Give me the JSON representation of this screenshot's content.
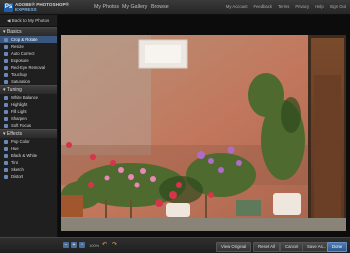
{
  "header": {
    "logo_line1": "ADOBE® PHOTOSHOP®",
    "logo_line2": "EXPRESS",
    "nav": [
      "My Photos",
      "My Gallery",
      "Browse"
    ],
    "links": [
      "My Account",
      "Feedback",
      "Terms",
      "Privacy",
      "Help",
      "Sign Out"
    ]
  },
  "sidebar": {
    "back": "◀ Back to My Photos",
    "sections": [
      {
        "title": "▾ Basics",
        "items": [
          "Crop & Rotate",
          "Resize",
          "Auto Correct",
          "Exposure",
          "Red-Eye Removal",
          "Touchup",
          "Saturation"
        ]
      },
      {
        "title": "▾ Tuning",
        "items": [
          "White Balance",
          "Highlight",
          "Fill Light",
          "Sharpen",
          "Soft Focus"
        ]
      },
      {
        "title": "▾ Effects",
        "items": [
          "Pop Color",
          "Hue",
          "Black & White",
          "Tint",
          "Sketch",
          "Distort"
        ]
      }
    ]
  },
  "footer": {
    "view_original": "View Original",
    "reset_all": "Reset All",
    "cancel": "Cancel",
    "save_as": "Save As...",
    "done": "Done",
    "zoom_label": "100%"
  }
}
